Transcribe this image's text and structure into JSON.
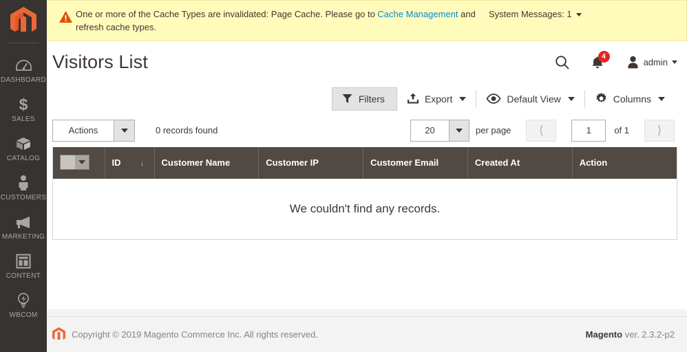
{
  "sidebar": {
    "logo_name": "magento-logo",
    "items": [
      {
        "label": "DASHBOARD",
        "icon": "dashboard-gauge-icon"
      },
      {
        "label": "SALES",
        "icon": "dollar-sign-icon"
      },
      {
        "label": "CATALOG",
        "icon": "box-icon"
      },
      {
        "label": "CUSTOMERS",
        "icon": "person-icon"
      },
      {
        "label": "MARKETING",
        "icon": "megaphone-icon"
      },
      {
        "label": "CONTENT",
        "icon": "layout-page-icon"
      },
      {
        "label": "WBCOM",
        "icon": "lightbulb-icon"
      }
    ]
  },
  "banner": {
    "message_part1": "One or more of the Cache Types are invalidated: Page Cache. Please go to ",
    "link_text": "Cache Management",
    "message_part2": " and refresh cache types.",
    "system_messages": "System Messages: 1",
    "bg_color": "#fffbbb",
    "link_color": "#008bdb",
    "icon": "warning-triangle-icon"
  },
  "header": {
    "title": "Visitors List",
    "search_icon": "search-icon",
    "notifications_count": "4",
    "notifications_badge_color": "#e22626",
    "admin_label": "admin"
  },
  "toolbar": {
    "filters_label": "Filters",
    "export_label": "Export",
    "default_view_label": "Default View",
    "columns_label": "Columns"
  },
  "grid_controls": {
    "actions_label": "Actions",
    "records_found": "0 records found",
    "per_page_value": "20",
    "per_page_label": "per page",
    "page_value": "1",
    "of_pages": "of 1"
  },
  "table": {
    "columns": [
      "ID",
      "Customer Name",
      "Customer IP",
      "Customer Email",
      "Created At",
      "Action"
    ],
    "sort_indicator": "↓",
    "header_bg": "#514943",
    "empty_message": "We couldn't find any records.",
    "rows": []
  },
  "footer": {
    "copyright": "Copyright © 2019 Magento Commerce Inc. All rights reserved.",
    "brand": "Magento",
    "version": "ver. 2.3.2-p2"
  }
}
